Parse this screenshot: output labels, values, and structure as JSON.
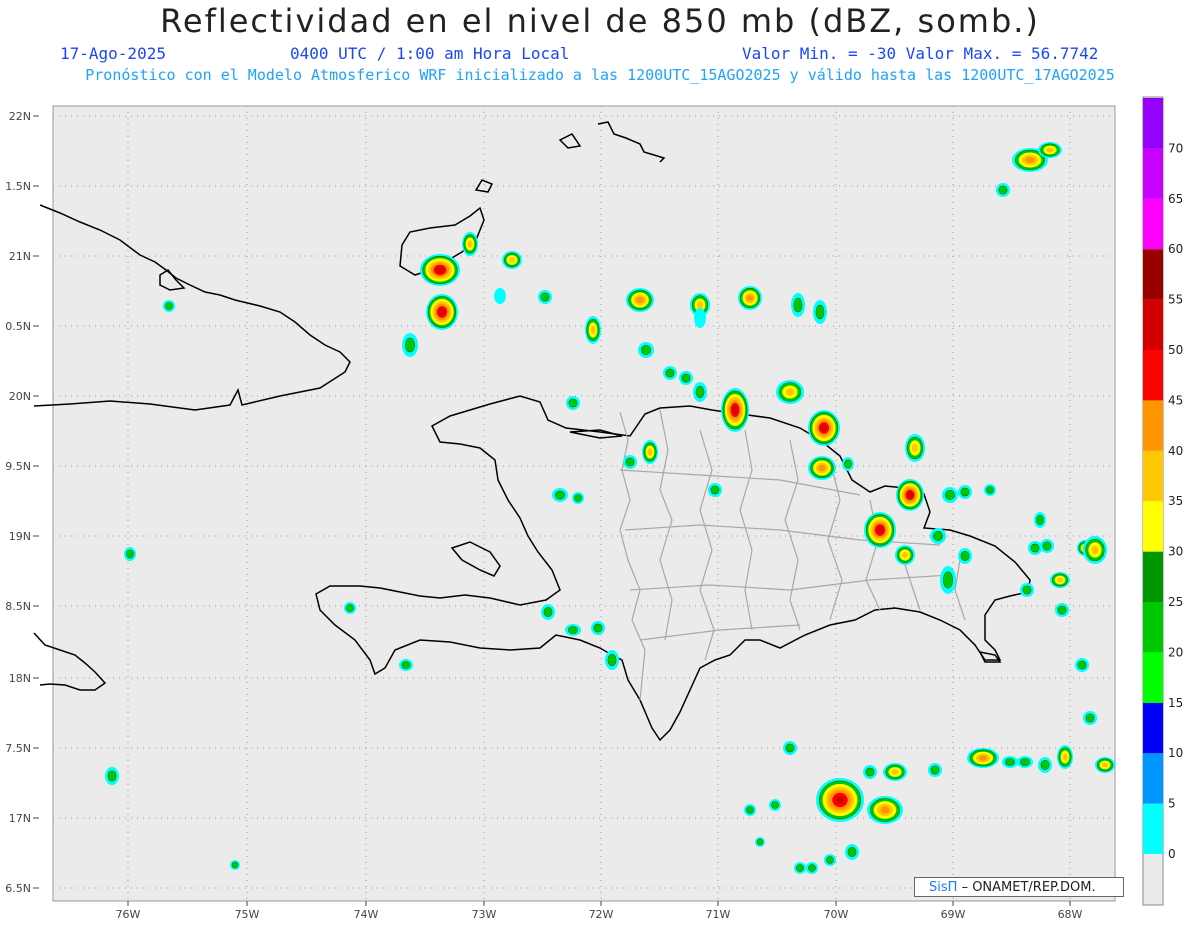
{
  "header": {
    "title": "Reflectividad en el nivel de 850 mb (dBZ, somb.)",
    "date": "17-Ago-2025",
    "time": "0400 UTC / 1:00 am Hora Local",
    "minmax": "Valor Min. = -30  Valor Max. = 56.7742",
    "forecast": "Pronóstico con el Modelo Atmosferico WRF inicializado a las 1200UTC_15AGO2025 y válido hasta las  1200UTC_17AGO2025"
  },
  "map": {
    "background": "#ebebeb",
    "coast_color": "#000000",
    "province_color": "#a0a0a0",
    "lat_labels": [
      "22N",
      "1.5N",
      "21N",
      "0.5N",
      "20N",
      "9.5N",
      "19N",
      "8.5N",
      "18N",
      "7.5N",
      "17N",
      "6.5N"
    ],
    "lon_labels": [
      "76W",
      "75W",
      "74W",
      "73W",
      "72W",
      "71W",
      "70W",
      "69W",
      "68W"
    ]
  },
  "legend": {
    "levels": [
      "0",
      "5",
      "10",
      "15",
      "20",
      "25",
      "30",
      "35",
      "40",
      "45",
      "50",
      "55",
      "60",
      "65",
      "70"
    ],
    "colors": [
      "#00ffff",
      "#0096ff",
      "#0000ff",
      "#00ff00",
      "#00c800",
      "#009600",
      "#ffff00",
      "#ffc800",
      "#ff9600",
      "#ff0000",
      "#d20000",
      "#9b0000",
      "#ff00ff",
      "#c800ff",
      "#9600ff"
    ]
  },
  "credit": {
    "brand": "SisΠ",
    "text": "– ONAMET/REP.DOM."
  }
}
